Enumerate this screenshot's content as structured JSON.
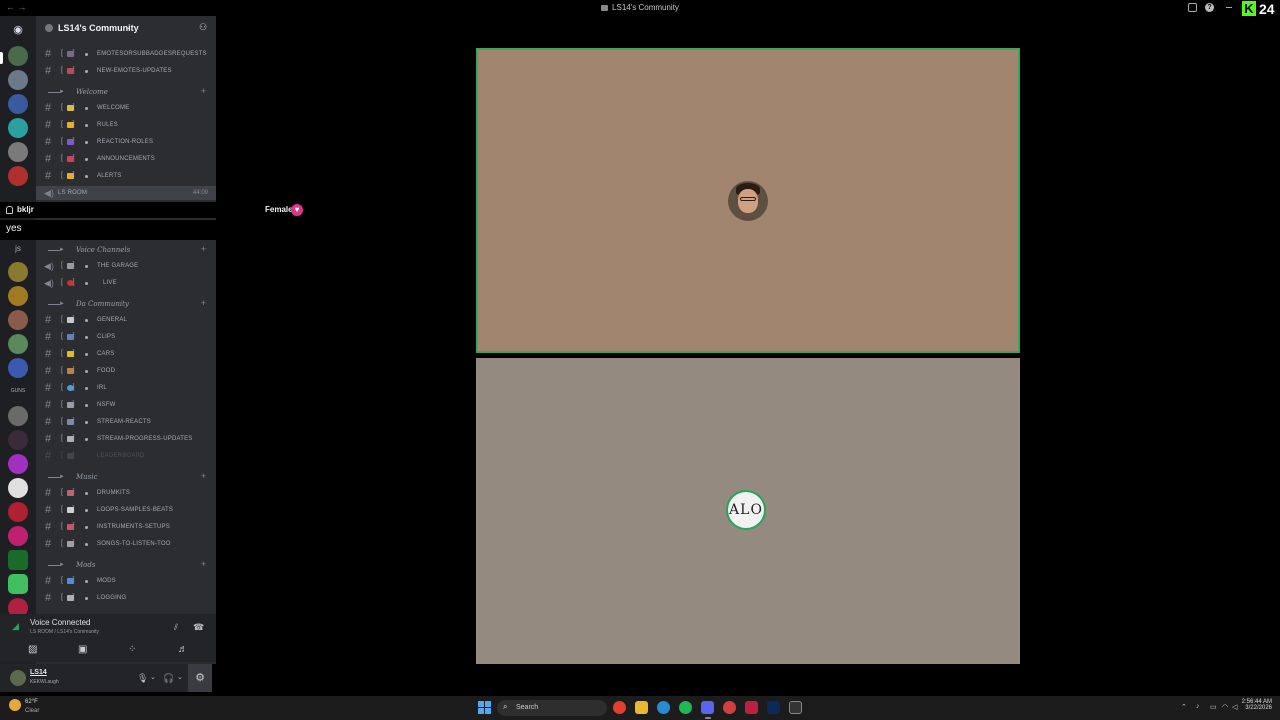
{
  "window": {
    "title": "LS14's Community"
  },
  "kick_overlay": {
    "logo_letter": "K",
    "count": "24"
  },
  "server": {
    "name": "LS14's Community"
  },
  "channels_top": [
    {
      "kind": "text",
      "emoji_color": "#7a6a8a",
      "name": "emotesorsubbadgesrequests"
    },
    {
      "kind": "text",
      "emoji_color": "#c0485a",
      "name": "new-emotes-updates"
    }
  ],
  "categories": {
    "welcome": "Welcome",
    "voice": "Voice Channels",
    "community": "Da Community",
    "music": "Music",
    "mods": "Mods"
  },
  "channels_welcome": [
    {
      "kind": "text",
      "emoji_color": "#e0b848",
      "name": "welcome"
    },
    {
      "kind": "text",
      "emoji_color": "#e8b020",
      "name": "rules"
    },
    {
      "kind": "text",
      "emoji_color": "#7a5ad0",
      "name": "reaction-roles"
    },
    {
      "kind": "text",
      "emoji_color": "#d04060",
      "name": "announcements"
    },
    {
      "kind": "text",
      "emoji_color": "#e8b020",
      "name": "alerts"
    }
  ],
  "active_room": {
    "name": "LS ROOM",
    "time": "44:09"
  },
  "overlay_user": {
    "username": "bkljr",
    "gender": "Female",
    "gender_symbol": "♥"
  },
  "overlay_reply": "yes",
  "channels_voice": [
    {
      "kind": "voice",
      "emoji_color": "#9a9a9a",
      "name": "the garage"
    },
    {
      "kind": "voice",
      "emoji_color": "#d03030",
      "name": "live"
    }
  ],
  "channels_community": [
    {
      "emoji_color": "#c8c8c8",
      "name": "general"
    },
    {
      "emoji_color": "#6080c0",
      "name": "clips"
    },
    {
      "emoji_color": "#e0c020",
      "name": "cars"
    },
    {
      "emoji_color": "#c08040",
      "name": "food"
    },
    {
      "emoji_color": "#4aa0d0",
      "name": "irl"
    },
    {
      "emoji_color": "#9a9aa8",
      "name": "nsfw"
    },
    {
      "emoji_color": "#7a8aa8",
      "name": "stream-reacts"
    },
    {
      "emoji_color": "#b0b0b0",
      "name": "stream-progress-updates"
    },
    {
      "emoji_color": "#555555",
      "name": "leaderboard"
    }
  ],
  "channels_music": [
    {
      "emoji_color": "#c06070",
      "name": "drumkits"
    },
    {
      "emoji_color": "#d0d0d0",
      "name": "loops-samples-beats"
    },
    {
      "emoji_color": "#d05070",
      "name": "instruments-setups"
    },
    {
      "emoji_color": "#a0a0a0",
      "name": "songs-to-listen-too"
    }
  ],
  "channels_mods": [
    {
      "emoji_color": "#4a90e0",
      "name": "mods"
    },
    {
      "emoji_color": "#b0b0b0",
      "name": "logging"
    }
  ],
  "rail_text": {
    "js": "js",
    "guns": "GUNS"
  },
  "voice_panel": {
    "status": "Voice Connected",
    "location": "LS ROOM / LS14's Community"
  },
  "user_panel": {
    "name": "LS14",
    "status": "KEKWLaugh"
  },
  "tiles": {
    "tile2_avatar_text": "ALO"
  },
  "taskbar": {
    "temp": "62°F",
    "condition": "Clear",
    "search_placeholder": "Search",
    "time": "2:56:44 AM",
    "date": "3/22/2026"
  },
  "colors": {
    "accent_green": "#3ba55c",
    "kick_green": "#53fc18",
    "tile1_bg": "#a2856e",
    "tile2_bg": "#948a7f"
  }
}
